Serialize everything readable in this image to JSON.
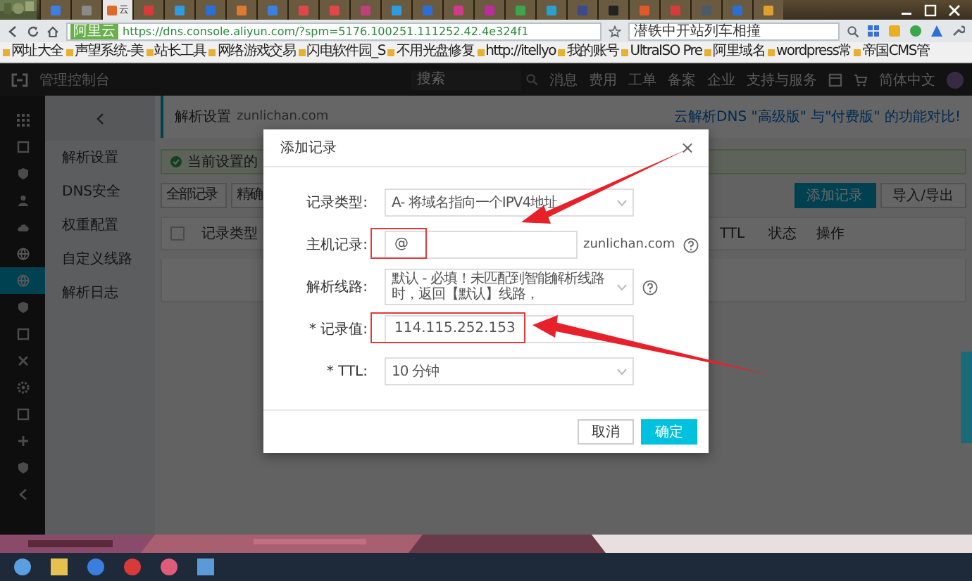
{
  "browser": {
    "tabs": [
      {
        "color": "#3b7fe0",
        "selected": false
      },
      {
        "color": "#8a8a8a",
        "selected": false
      },
      {
        "color": "#e06a2a",
        "selected": true,
        "label": "云"
      },
      {
        "color": "#d83a3a",
        "selected": false
      },
      {
        "color": "#2f9be0",
        "selected": false
      },
      {
        "color": "#2a6fd8",
        "selected": false
      },
      {
        "color": "#e07a30",
        "selected": false
      },
      {
        "color": "#3b7fe0",
        "selected": false
      },
      {
        "color": "#e04848",
        "selected": false
      },
      {
        "color": "#e04848",
        "selected": false
      },
      {
        "color": "#c0407a",
        "selected": false
      },
      {
        "color": "#2f9be0",
        "selected": false
      },
      {
        "color": "#2a6fd8",
        "selected": false
      },
      {
        "color": "#d03a8a",
        "selected": false
      },
      {
        "color": "#c02aa0",
        "selected": false
      },
      {
        "color": "#3aa84a",
        "selected": false
      },
      {
        "color": "#2aa0d0",
        "selected": false
      },
      {
        "color": "#3a4a8a",
        "selected": false
      },
      {
        "color": "#222222",
        "selected": false
      },
      {
        "color": "#e05a2a",
        "selected": false
      },
      {
        "color": "#d83a3a",
        "selected": false
      },
      {
        "color": "#4a5a6a",
        "selected": false
      },
      {
        "color": "#2a6fd8",
        "selected": false
      },
      {
        "color": "#e0a030",
        "selected": false
      }
    ],
    "address_badge": "阿里云",
    "url": "https://dns.console.aliyun.com/?spm=5176.100251.111252.42.4e324f1",
    "search_value": "潜铁中开站列车相撞",
    "bookmarks": [
      "网址大全",
      "声望系统-美",
      "站长工具",
      "网络游戏交易",
      "闪电软件园_S",
      "不用光盘修复",
      "http://itellyo",
      "我的账号",
      "UltraISO Pre",
      "阿里域名",
      "wordpress常",
      "帝国CMS管"
    ]
  },
  "console": {
    "brand": "管理控制台",
    "search": {
      "placeholder": "搜索"
    },
    "nav": [
      "消息",
      "费用",
      "工单",
      "备案",
      "企业",
      "支持与服务"
    ],
    "language": "简体中文"
  },
  "rail": [
    {
      "selected": false
    },
    {
      "selected": false
    },
    {
      "selected": false
    },
    {
      "selected": false
    },
    {
      "selected": false
    },
    {
      "selected": false
    },
    {
      "selected": true
    },
    {
      "selected": false
    },
    {
      "selected": false
    },
    {
      "selected": false
    },
    {
      "selected": false
    },
    {
      "selected": false
    },
    {
      "selected": false
    },
    {
      "selected": false
    },
    {
      "selected": false
    }
  ],
  "sidebar": {
    "items": [
      "解析设置",
      "DNS安全",
      "权重配置",
      "自定义线路",
      "解析日志"
    ]
  },
  "page": {
    "title": "解析设置",
    "domain": "zunlichan.com",
    "compare_link": "云解析DNS \"高级版\" 与\"付费版\" 的功能对比!",
    "alert": "当前设置的",
    "filters": [
      "全部记录",
      "精确"
    ],
    "buttons": [
      {
        "label": "添加记录",
        "primary": true
      },
      {
        "label": "导入/导出",
        "primary": false
      }
    ],
    "select_all": {
      "checked": false
    },
    "columns": [
      "记录类型",
      "TTL",
      "状态",
      "操作"
    ]
  },
  "dialog": {
    "title": "添加记录",
    "close": "×",
    "fields": [
      {
        "kind": "select",
        "label": "记录类型:",
        "value": "A- 将域名指向一个IPV4地址",
        "help": false,
        "highlight": false
      },
      {
        "kind": "input",
        "label": "主机记录:",
        "value": "@",
        "suffix": "zunlichan.com",
        "help": true,
        "highlight": true
      },
      {
        "kind": "select",
        "label": "解析线路:",
        "value": "默认 - 必填！未匹配到智能解析线路时，返回【默认】线路，",
        "help": true,
        "highlight": false
      },
      {
        "kind": "input",
        "label": "* 记录值:",
        "value": "114.115.252.153",
        "help": false,
        "highlight": true
      },
      {
        "kind": "select",
        "label": "* TTL:",
        "value": "10 分钟",
        "help": false,
        "highlight": false
      }
    ],
    "buttons": [
      {
        "label": "取消",
        "primary": false
      },
      {
        "label": "确定",
        "primary": true
      }
    ]
  }
}
